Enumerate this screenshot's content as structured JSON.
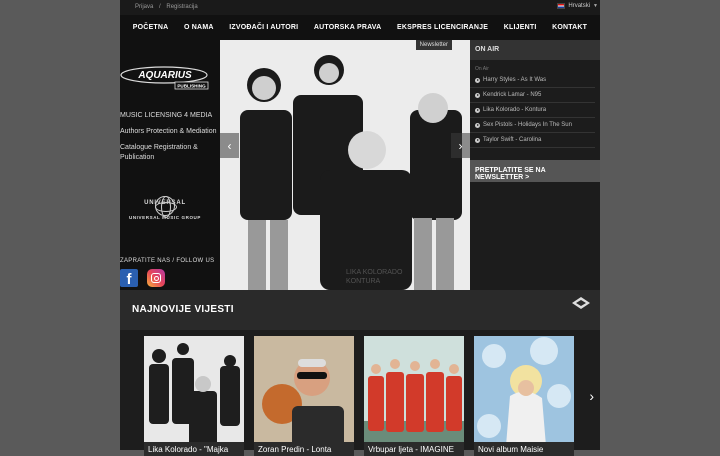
{
  "topbar": {
    "login": "Prijava",
    "sep": "/",
    "register": "Registracija",
    "language": "Hrvatski"
  },
  "nav": [
    "POČETNA",
    "O NAMA",
    "IZVOĐAČI I AUTORI",
    "AUTORSKA PRAVA",
    "EKSPRES LICENCIRANJE",
    "KLIJENTI",
    "KONTAKT"
  ],
  "sidebar": {
    "logo_text": "AQUARIUS",
    "logo_sub": "PUBLISHING",
    "links": [
      "MUSIC LICENSING 4 MEDIA",
      "Authors Protection & Mediation",
      "Catalogue Registration & Publication"
    ],
    "partner": {
      "name": "UNIVERSAL",
      "sub": "UNIVERSAL MUSIC GROUP"
    },
    "follow": "ZAPRATITE NAS / FOLLOW US"
  },
  "hero": {
    "tab": "Newsletter",
    "caption_line1": "LIKA KOLORADO",
    "caption_line2": "KONTURA"
  },
  "onair": {
    "title": "ON AIR",
    "subtitle": "On Air",
    "tracks": [
      "Harry Styles - As It Was",
      "Kendrick Lamar - N95",
      "Lika Kolorado - Kontura",
      "Sex Pistols - Holidays In The Sun",
      "Taylor Swift - Carolina"
    ],
    "subscribe": "PRETPLATITE SE NA NEWSLETTER >"
  },
  "news": {
    "title": "NAJNOVIJE VIJESTI",
    "cards": [
      "Lika Kolorado - \"Majka",
      "Zoran Predin - Lonta",
      "Vrbupar ljeta - IMAGINE",
      "Novi album Maisie"
    ]
  },
  "colors": {
    "background": "#111111",
    "accent_panel": "#333333"
  }
}
